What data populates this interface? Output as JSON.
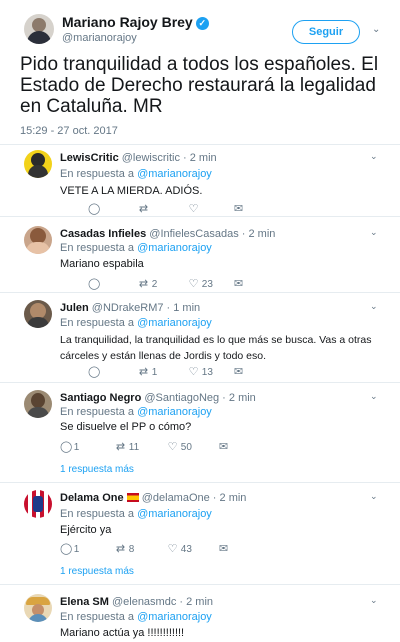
{
  "main_tweet": {
    "name": "Mariano Rajoy Brey",
    "handle": "@marianorajoy",
    "follow_label": "Seguir",
    "text": "Pido tranquilidad a todos los españoles. El Estado de Derecho restaurará la legalidad en Cataluña. MR",
    "timestamp": "15:29 - 27 oct. 2017"
  },
  "reply_prefix": "En respuesta a",
  "more_replies_label": "1 respuesta más",
  "replies": [
    {
      "name": "LewisCritic",
      "meta": "@lewiscritic · 2 min",
      "mention": "@marianorajoy",
      "text": "VETE A LA MIERDA. ADIÓS.",
      "reply_count": "",
      "retweet_count": "",
      "like_count": ""
    },
    {
      "name": "Casadas Infieles",
      "meta": "@InfielesCasadas · 2 min",
      "mention": "@marianorajoy",
      "text": "Mariano espabila",
      "reply_count": "",
      "retweet_count": "2",
      "like_count": "23"
    },
    {
      "name": "Julen",
      "meta": "@NDrakeRM7 · 1 min",
      "mention": "@marianorajoy",
      "text": "La tranquilidad, la tranquilidad es lo que más se busca. Vas a otras cárceles y están llenas de Jordis y todo eso.",
      "reply_count": "",
      "retweet_count": "1",
      "like_count": "13"
    },
    {
      "name": "Santiago Negro",
      "meta": "@SantiagoNeg · 2 min",
      "mention": "@marianorajoy",
      "text": "Se disuelve el PP o cómo?",
      "reply_count": "1",
      "retweet_count": "11",
      "like_count": "50"
    },
    {
      "name": "Delama One",
      "meta": "@delamaOne · 2 min",
      "mention": "@marianorajoy",
      "text": "Ejército ya",
      "reply_count": "1",
      "retweet_count": "8",
      "like_count": "43"
    },
    {
      "name": "Elena SM",
      "meta": "@elenasmdc · 2 min",
      "mention": "@marianorajoy",
      "text": "Mariano actúa ya !!!!!!!!!!!!"
    }
  ],
  "icons": {
    "reply": "reply-icon",
    "retweet": "retweet-icon",
    "like": "heart-icon",
    "dm": "envelope-icon",
    "verified": "verified-badge-icon",
    "caret": "chevron-down-icon",
    "flag": "spain-flag-icon"
  },
  "colors": {
    "accent": "#1da1f2",
    "muted": "#657786",
    "text": "#14171a",
    "border": "#e6ecf0"
  }
}
